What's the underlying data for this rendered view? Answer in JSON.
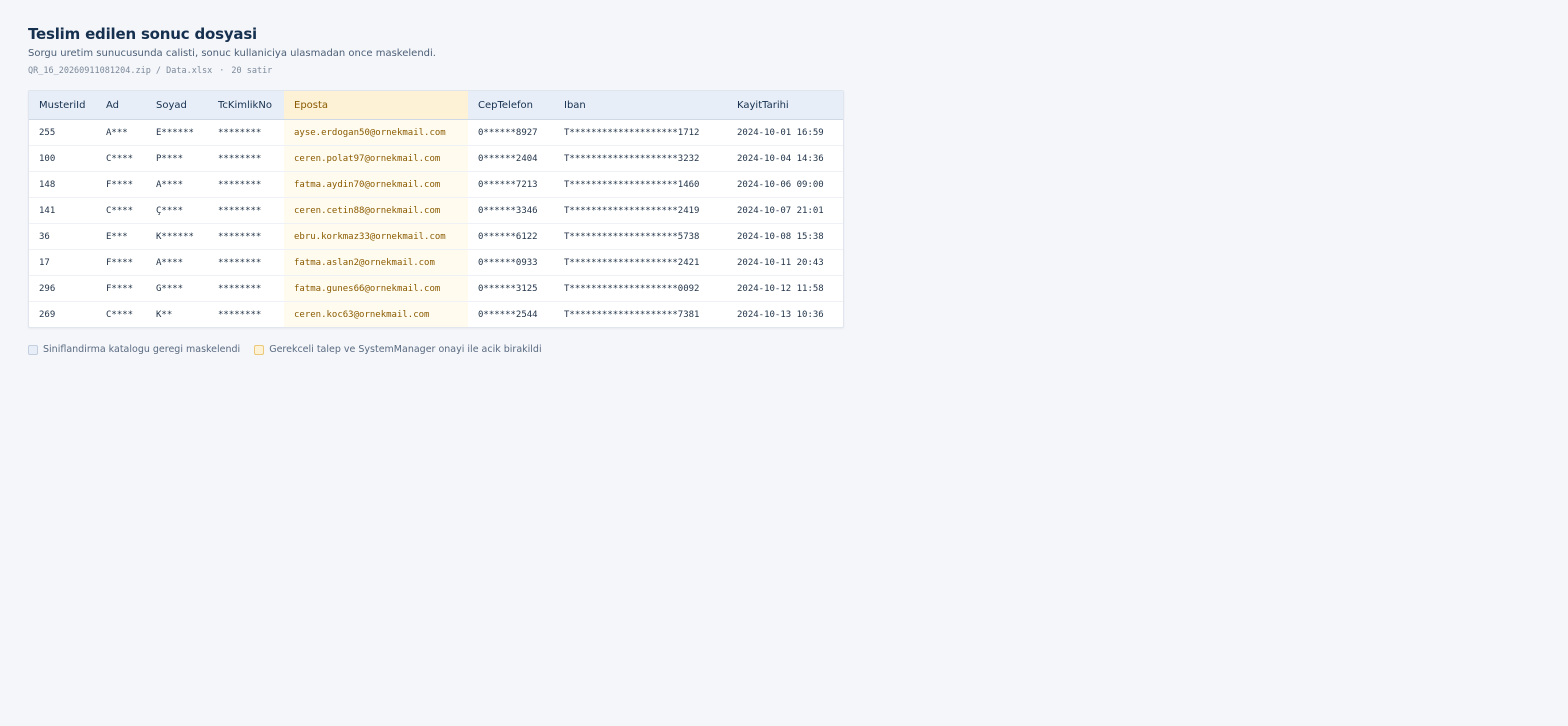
{
  "header": {
    "title": "Teslim edilen sonuc dosyasi",
    "subtitle": "Sorgu uretim sunucusunda calisti, sonuc kullaniciya ulasmadan once maskelendi.",
    "file_path": "QR_16_20260911081204.zip / Data.xlsx",
    "separator": "·",
    "row_count": "20 satir"
  },
  "colors": {
    "masked_header_bg": "#e8eef7",
    "open_header_bg": "#fdf1d6",
    "open_cell_bg": "#fffbef",
    "open_text": "#8a5b00"
  },
  "table": {
    "columns": [
      {
        "label": "MusteriId",
        "status": "masked"
      },
      {
        "label": "Ad",
        "status": "masked"
      },
      {
        "label": "Soyad",
        "status": "masked"
      },
      {
        "label": "TcKimlikNo",
        "status": "masked"
      },
      {
        "label": "Eposta",
        "status": "open"
      },
      {
        "label": "CepTelefon",
        "status": "masked"
      },
      {
        "label": "Iban",
        "status": "masked"
      },
      {
        "label": "KayitTarihi",
        "status": "masked"
      }
    ],
    "rows": [
      [
        "255",
        "A***",
        "E******",
        "********",
        "ayse.erdogan50@ornekmail.com",
        "0******8927",
        "T********************1712",
        "2024-10-01 16:59"
      ],
      [
        "100",
        "C****",
        "P****",
        "********",
        "ceren.polat97@ornekmail.com",
        "0******2404",
        "T********************3232",
        "2024-10-04 14:36"
      ],
      [
        "148",
        "F****",
        "A****",
        "********",
        "fatma.aydin70@ornekmail.com",
        "0******7213",
        "T********************1460",
        "2024-10-06 09:00"
      ],
      [
        "141",
        "C****",
        "Ç****",
        "********",
        "ceren.cetin88@ornekmail.com",
        "0******3346",
        "T********************2419",
        "2024-10-07 21:01"
      ],
      [
        "36",
        "E***",
        "K******",
        "********",
        "ebru.korkmaz33@ornekmail.com",
        "0******6122",
        "T********************5738",
        "2024-10-08 15:38"
      ],
      [
        "17",
        "F****",
        "A****",
        "********",
        "fatma.aslan2@ornekmail.com",
        "0******0933",
        "T********************2421",
        "2024-10-11 20:43"
      ],
      [
        "296",
        "F****",
        "G****",
        "********",
        "fatma.gunes66@ornekmail.com",
        "0******3125",
        "T********************0092",
        "2024-10-12 11:58"
      ],
      [
        "269",
        "C****",
        "K**",
        "********",
        "ceren.koc63@ornekmail.com",
        "0******2544",
        "T********************7381",
        "2024-10-13 10:36"
      ]
    ]
  },
  "legend": {
    "masked_label": "Siniflandirma katalogu geregi maskelendi",
    "open_label": "Gerekceli talep ve SystemManager onayi ile acik birakildi"
  }
}
